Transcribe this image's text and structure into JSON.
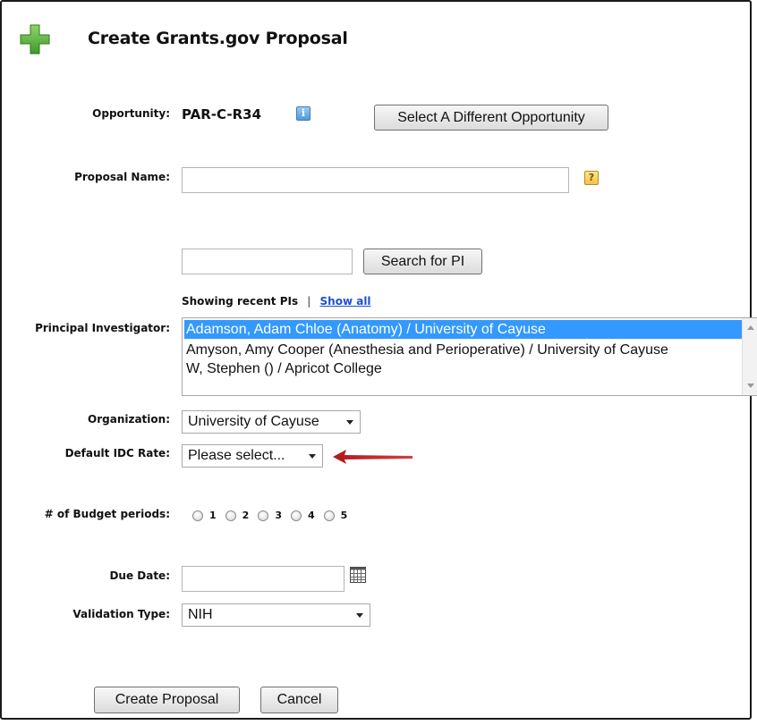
{
  "header": {
    "title": "Create Grants.gov Proposal",
    "icon": "green-plus-icon",
    "icon_color": "#4caf3a"
  },
  "form": {
    "opportunity": {
      "label": "Opportunity:",
      "value": "PAR-C-R34",
      "change_button": "Select A Different Opportunity"
    },
    "proposal_name": {
      "label": "Proposal Name:",
      "value": "",
      "help_icon": "question-icon"
    },
    "pi_search": {
      "value": "",
      "button": "Search for PI"
    },
    "recent_pis": {
      "text": "Showing recent PIs",
      "separator": "|",
      "show_all": "Show all"
    },
    "principal_investigator": {
      "label": "Principal Investigator:",
      "options": [
        "Adamson, Adam Chloe (Anatomy) / University of Cayuse",
        "Amyson, Amy Cooper (Anesthesia and Perioperative) / University of Cayuse",
        "W, Stephen () / Apricot College"
      ],
      "selected_index": 0
    },
    "organization": {
      "label": "Organization:",
      "value": "University of Cayuse"
    },
    "idc_rate": {
      "label": "Default IDC Rate:",
      "value": "Please select..."
    },
    "budget_periods": {
      "label": "# of Budget periods:",
      "options": [
        "1",
        "2",
        "3",
        "4",
        "5"
      ]
    },
    "due_date": {
      "label": "Due Date:",
      "value": ""
    },
    "validation_type": {
      "label": "Validation Type:",
      "value": "NIH"
    }
  },
  "buttons": {
    "create": "Create Proposal",
    "cancel": "Cancel"
  },
  "colors": {
    "arrow": "#b01818",
    "selection": "#3399ff",
    "link": "#1f4fd0"
  }
}
